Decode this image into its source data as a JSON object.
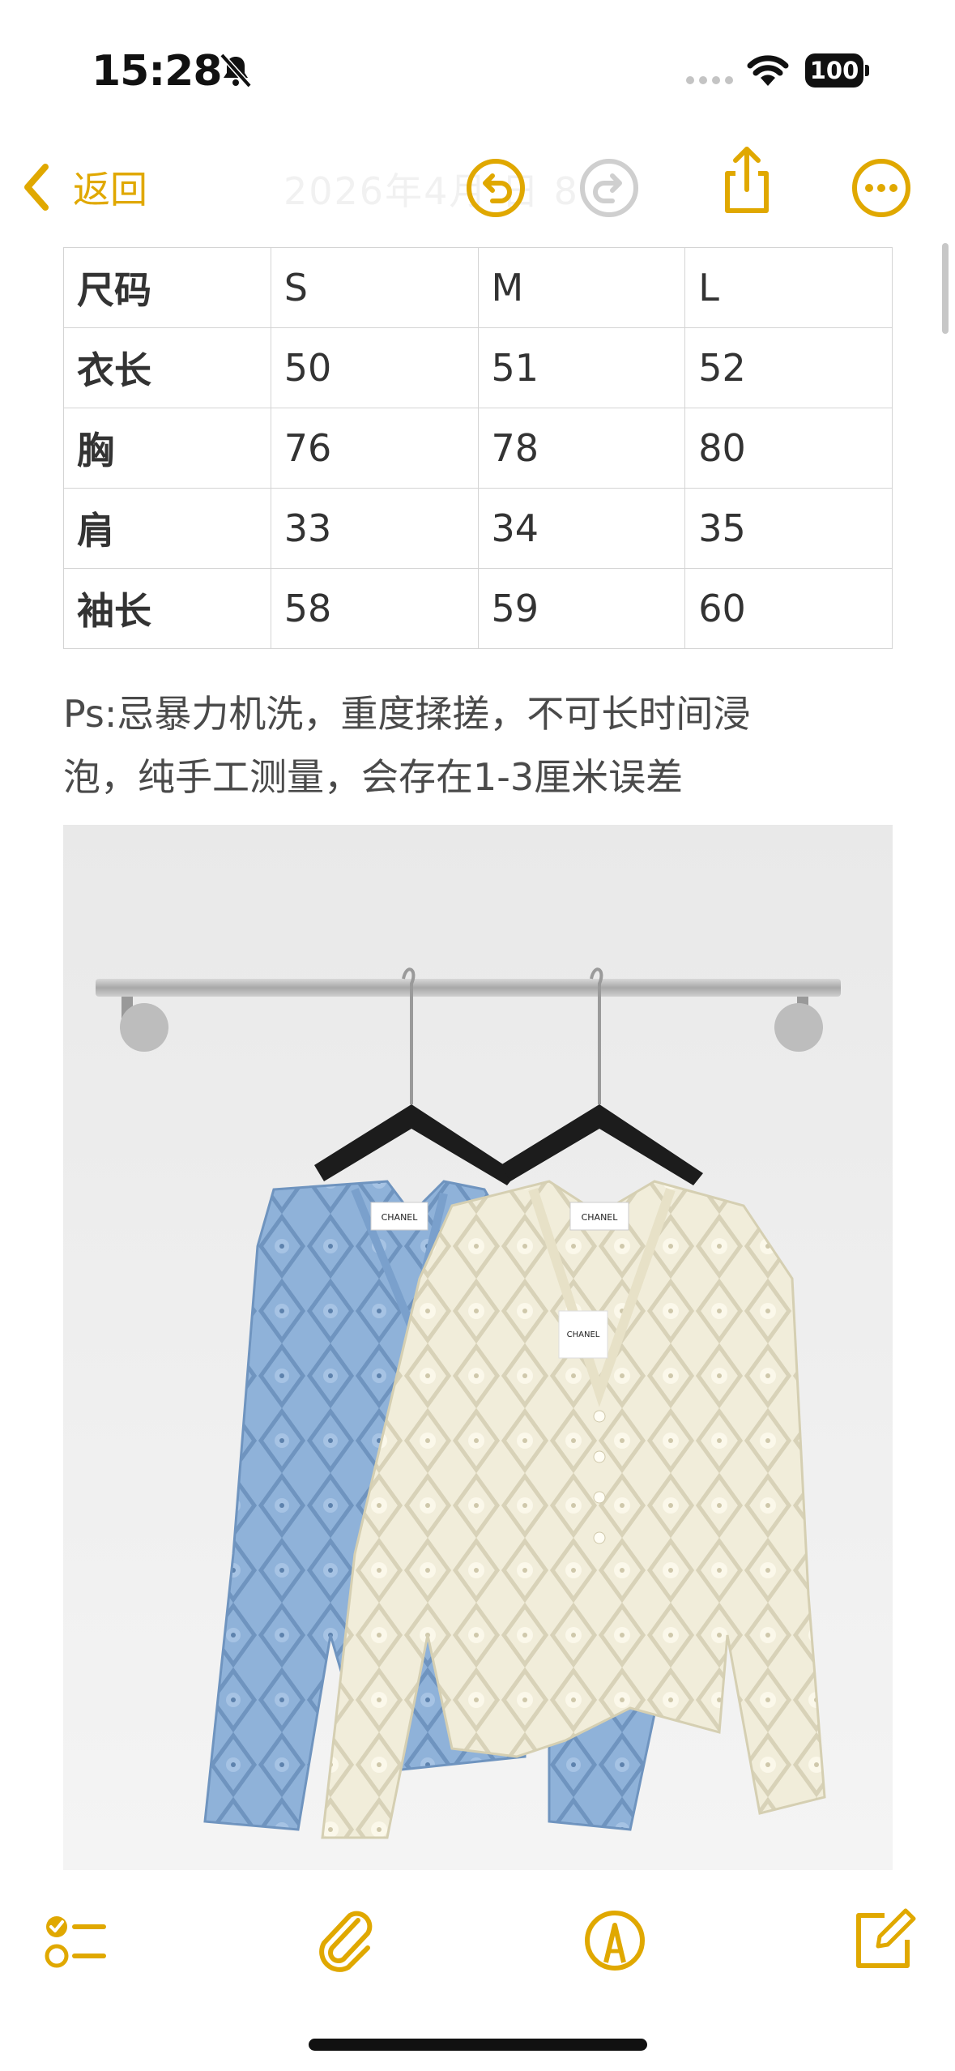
{
  "status_bar": {
    "time": "15:28",
    "battery": "100"
  },
  "nav": {
    "back_label": "返回",
    "title": "2026年4月 日 8"
  },
  "size_table": {
    "rows": [
      [
        "尺码",
        "S",
        "M",
        "L"
      ],
      [
        "衣长",
        "50",
        "51",
        "52"
      ],
      [
        "胸",
        "76",
        "78",
        "80"
      ],
      [
        "肩",
        "33",
        "34",
        "35"
      ],
      [
        "袖长",
        "58",
        "59",
        "60"
      ]
    ]
  },
  "note": {
    "line1": "Ps:忌暴力机洗，重度揉搓，不可长时间浸",
    "line2": "泡，纯手工测量，会存在1-3厘米误差"
  },
  "photo": {
    "label_left": "CHANEL",
    "label_right": "CHANEL",
    "tag_text": "CHANEL"
  },
  "colors": {
    "accent": "#e0a800",
    "cardigan_blue": "#8fb2d9",
    "cardigan_cream": "#f1edda"
  },
  "icons": [
    "mute-icon",
    "signal-icon",
    "wifi-icon",
    "battery-icon",
    "back-chevron-icon",
    "undo-icon",
    "redo-icon",
    "share-icon",
    "more-icon",
    "checklist-icon",
    "paperclip-icon",
    "markup-pen-icon",
    "compose-icon"
  ]
}
